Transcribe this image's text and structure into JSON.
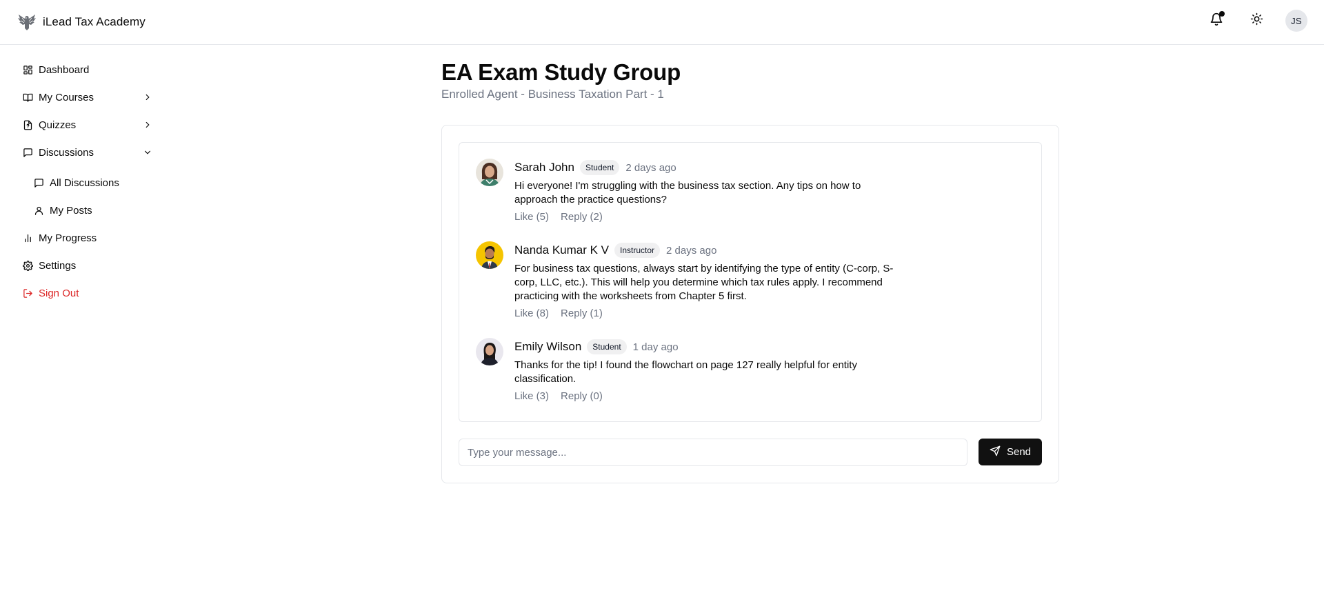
{
  "header": {
    "app_name": "iLead Tax Academy",
    "logo_icon": "eagle-logo",
    "user_initials": "JS",
    "has_notification_dot": true
  },
  "sidebar": {
    "items": [
      {
        "label": "Dashboard",
        "icon": "dashboard-icon"
      },
      {
        "label": "My Courses",
        "icon": "book-icon",
        "expand": "chevron-right"
      },
      {
        "label": "Quizzes",
        "icon": "quiz-file-icon",
        "expand": "chevron-right"
      },
      {
        "label": "Discussions",
        "icon": "message-square-icon",
        "expand": "chevron-down"
      },
      {
        "label": "All Discussions",
        "icon": "message-square-icon",
        "sub": true
      },
      {
        "label": "My Posts",
        "icon": "user-icon",
        "sub": true
      },
      {
        "label": "My Progress",
        "icon": "bar-chart-icon"
      },
      {
        "label": "Settings",
        "icon": "gear-icon"
      },
      {
        "label": "Sign Out",
        "icon": "logout-icon",
        "danger": true
      }
    ]
  },
  "main": {
    "title": "EA Exam Study Group",
    "subtitle": "Enrolled Agent - Business Taxation Part - 1"
  },
  "messages": [
    {
      "author": "Sarah John",
      "role": "Student",
      "time": "2 days ago",
      "text": "Hi everyone! I'm struggling with the business tax section. Any tips on how to approach the practice questions?",
      "like": "Like (5)",
      "reply": "Reply (2)"
    },
    {
      "author": "Nanda Kumar K V",
      "role": "Instructor",
      "time": "2 days ago",
      "text": "For business tax questions, always start by identifying the type of entity (C-corp, S- corp, LLC, etc.). This will help you determine which tax rules apply. I recommend practicing with the worksheets from Chapter 5 first.",
      "like": "Like (8)",
      "reply": "Reply (1)"
    },
    {
      "author": "Emily Wilson",
      "role": "Student",
      "time": "1 day ago",
      "text": "Thanks for the tip! I found the flowchart on page 127 really helpful for entity classification.",
      "like": "Like (3)",
      "reply": "Reply (0)"
    }
  ],
  "composer": {
    "placeholder": "Type your message...",
    "value": "",
    "send_label": "Send"
  },
  "colors": {
    "accent": "#111111",
    "danger": "#dc2626",
    "muted": "#6b7280",
    "border": "#e5e7eb"
  }
}
